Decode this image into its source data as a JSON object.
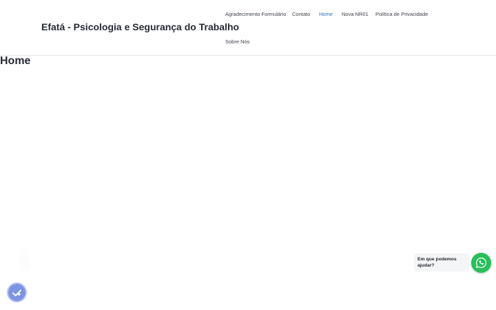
{
  "header": {
    "site_title": "Efatá - Psicologia e Segurança do Trabalho",
    "nav": [
      {
        "label": "Agradecimento Formulário",
        "active": false
      },
      {
        "label": "Contato",
        "active": false
      },
      {
        "label": "Home",
        "active": true
      },
      {
        "label": "Nova NR01",
        "active": false
      },
      {
        "label": "Política de Privacidade",
        "active": false
      },
      {
        "label": "Sobre Nós",
        "active": false
      }
    ]
  },
  "main": {
    "page_title": "Home"
  },
  "whatsapp": {
    "bubble_text": "Em que podemos ajudar?",
    "icon": "whatsapp-icon",
    "color": "#25c05a"
  },
  "accessibility": {
    "icon": "accessibility-icon",
    "color": "#7d93e4"
  },
  "colors": {
    "nav_active": "#2b70c9",
    "text": "#262b33"
  }
}
